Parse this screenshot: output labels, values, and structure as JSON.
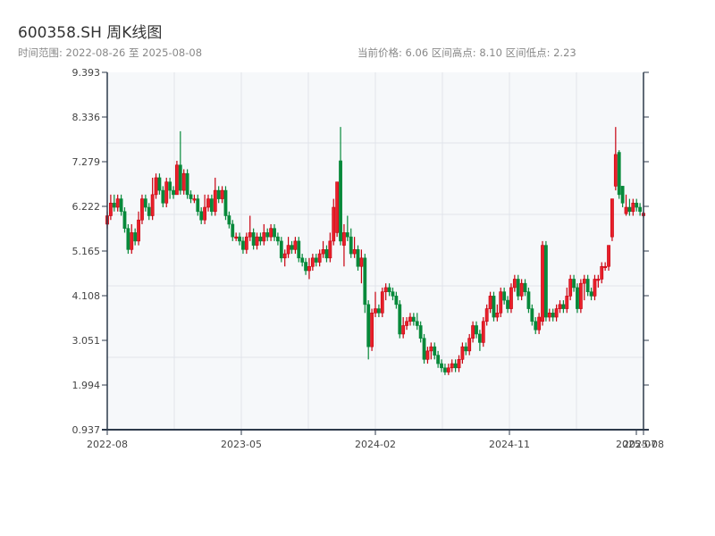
{
  "header": {
    "title": "600358.SH 周K线图",
    "range_text": "时间范围: 2022-08-26 至 2025-08-08",
    "stats_text": "当前价格: 6.06  区间高点: 8.10  区间低点: 2.23"
  },
  "chart_data": {
    "type": "candlestick",
    "title": "600358.SH 周K线图",
    "date_range": [
      "2022-08-26",
      "2025-08-08"
    ],
    "frequency": "weekly",
    "ylim": [
      0.937,
      9.393
    ],
    "y_ticks": [
      "0.937",
      "1.994",
      "3.051",
      "4.108",
      "5.165",
      "6.222",
      "7.279",
      "8.336",
      "9.393"
    ],
    "x_ticks": [
      "2022-08",
      "2023-05",
      "2024-02",
      "2024-11",
      "2025-07",
      "2025-08"
    ],
    "grid": true,
    "colors": {
      "up": "#e8202a",
      "up_edge": "#c8000f",
      "down": "#07893a",
      "background": "#f6f8fa"
    },
    "ohlc_fields": [
      "open",
      "high",
      "low",
      "close"
    ],
    "candles": [
      [
        5.8,
        6.1,
        5.7,
        6.0
      ],
      [
        6.0,
        6.5,
        5.9,
        6.3
      ],
      [
        6.3,
        6.5,
        6.1,
        6.2
      ],
      [
        6.2,
        6.5,
        6.1,
        6.4
      ],
      [
        6.4,
        6.5,
        6.0,
        6.1
      ],
      [
        6.1,
        6.2,
        5.6,
        5.7
      ],
      [
        5.7,
        5.8,
        5.1,
        5.2
      ],
      [
        5.2,
        5.8,
        5.1,
        5.6
      ],
      [
        5.6,
        5.7,
        5.3,
        5.4
      ],
      [
        5.4,
        6.1,
        5.3,
        5.9
      ],
      [
        5.9,
        6.5,
        5.8,
        6.4
      ],
      [
        6.4,
        6.5,
        6.1,
        6.2
      ],
      [
        6.2,
        6.3,
        5.9,
        6.0
      ],
      [
        6.0,
        6.9,
        5.9,
        6.5
      ],
      [
        6.5,
        7.0,
        6.4,
        6.9
      ],
      [
        6.9,
        7.0,
        6.5,
        6.6
      ],
      [
        6.6,
        6.7,
        6.2,
        6.3
      ],
      [
        6.3,
        6.9,
        6.2,
        6.8
      ],
      [
        6.8,
        6.9,
        6.4,
        6.6
      ],
      [
        6.6,
        6.7,
        6.4,
        6.5
      ],
      [
        6.5,
        7.3,
        6.5,
        7.2
      ],
      [
        7.2,
        8.0,
        6.5,
        6.6
      ],
      [
        6.6,
        7.1,
        6.5,
        7.0
      ],
      [
        7.0,
        7.1,
        6.4,
        6.5
      ],
      [
        6.5,
        6.6,
        6.3,
        6.4
      ],
      [
        6.4,
        6.5,
        6.3,
        6.4
      ],
      [
        6.4,
        6.5,
        6.0,
        6.1
      ],
      [
        6.1,
        6.2,
        5.8,
        5.9
      ],
      [
        5.9,
        6.5,
        5.8,
        6.2
      ],
      [
        6.2,
        6.5,
        6.1,
        6.4
      ],
      [
        6.4,
        6.5,
        6.0,
        6.1
      ],
      [
        6.1,
        6.9,
        6.0,
        6.6
      ],
      [
        6.6,
        6.7,
        6.3,
        6.4
      ],
      [
        6.4,
        6.7,
        6.3,
        6.6
      ],
      [
        6.6,
        6.7,
        5.9,
        6.0
      ],
      [
        6.0,
        6.1,
        5.7,
        5.8
      ],
      [
        5.8,
        5.9,
        5.4,
        5.5
      ],
      [
        5.5,
        5.6,
        5.4,
        5.5
      ],
      [
        5.5,
        5.6,
        5.3,
        5.4
      ],
      [
        5.4,
        5.5,
        5.1,
        5.2
      ],
      [
        5.2,
        5.6,
        5.1,
        5.5
      ],
      [
        5.5,
        6.0,
        5.4,
        5.6
      ],
      [
        5.6,
        5.7,
        5.2,
        5.3
      ],
      [
        5.3,
        5.6,
        5.2,
        5.5
      ],
      [
        5.5,
        5.6,
        5.3,
        5.4
      ],
      [
        5.4,
        5.8,
        5.3,
        5.6
      ],
      [
        5.6,
        5.7,
        5.4,
        5.5
      ],
      [
        5.5,
        5.8,
        5.4,
        5.7
      ],
      [
        5.7,
        5.8,
        5.4,
        5.5
      ],
      [
        5.5,
        5.6,
        5.3,
        5.4
      ],
      [
        5.4,
        5.5,
        4.9,
        5.0
      ],
      [
        5.0,
        5.2,
        4.8,
        5.1
      ],
      [
        5.1,
        5.5,
        5.0,
        5.3
      ],
      [
        5.3,
        5.4,
        5.1,
        5.2
      ],
      [
        5.2,
        5.5,
        5.1,
        5.4
      ],
      [
        5.4,
        5.5,
        4.9,
        5.0
      ],
      [
        5.0,
        5.1,
        4.8,
        4.9
      ],
      [
        4.9,
        5.0,
        4.6,
        4.7
      ],
      [
        4.7,
        5.0,
        4.5,
        4.8
      ],
      [
        4.8,
        5.1,
        4.7,
        5.0
      ],
      [
        5.0,
        5.1,
        4.8,
        4.9
      ],
      [
        4.9,
        5.2,
        4.8,
        5.1
      ],
      [
        5.1,
        5.4,
        5.0,
        5.2
      ],
      [
        5.2,
        5.3,
        4.9,
        5.0
      ],
      [
        5.0,
        5.6,
        4.9,
        5.4
      ],
      [
        5.4,
        6.4,
        5.3,
        6.2
      ],
      [
        5.6,
        6.8,
        5.5,
        6.8
      ],
      [
        7.3,
        8.1,
        5.3,
        5.4
      ],
      [
        5.3,
        5.8,
        4.8,
        5.6
      ],
      [
        5.6,
        6.0,
        5.4,
        5.5
      ],
      [
        5.5,
        5.7,
        5.0,
        5.1
      ],
      [
        5.1,
        5.5,
        5.0,
        5.2
      ],
      [
        5.2,
        5.3,
        4.7,
        4.8
      ],
      [
        4.8,
        5.2,
        4.4,
        5.0
      ],
      [
        5.0,
        5.1,
        3.7,
        3.9
      ],
      [
        3.9,
        4.0,
        2.6,
        2.9
      ],
      [
        2.9,
        3.8,
        2.8,
        3.7
      ],
      [
        3.7,
        4.2,
        3.6,
        3.8
      ],
      [
        3.8,
        3.9,
        3.6,
        3.7
      ],
      [
        3.7,
        4.3,
        3.6,
        4.2
      ],
      [
        4.2,
        4.4,
        4.0,
        4.3
      ],
      [
        4.3,
        4.4,
        4.1,
        4.2
      ],
      [
        4.2,
        4.3,
        4.0,
        4.1
      ],
      [
        4.1,
        4.2,
        3.8,
        3.9
      ],
      [
        3.9,
        4.0,
        3.1,
        3.2
      ],
      [
        3.2,
        3.6,
        3.1,
        3.4
      ],
      [
        3.4,
        3.6,
        3.3,
        3.5
      ],
      [
        3.5,
        3.7,
        3.4,
        3.6
      ],
      [
        3.6,
        3.7,
        3.4,
        3.5
      ],
      [
        3.5,
        3.7,
        3.3,
        3.4
      ],
      [
        3.4,
        3.5,
        3.0,
        3.1
      ],
      [
        3.1,
        3.2,
        2.5,
        2.6
      ],
      [
        2.6,
        2.9,
        2.5,
        2.8
      ],
      [
        2.8,
        3.0,
        2.6,
        2.9
      ],
      [
        2.9,
        3.0,
        2.6,
        2.7
      ],
      [
        2.7,
        2.8,
        2.4,
        2.5
      ],
      [
        2.5,
        2.6,
        2.3,
        2.4
      ],
      [
        2.4,
        2.5,
        2.23,
        2.3
      ],
      [
        2.3,
        2.5,
        2.23,
        2.4
      ],
      [
        2.4,
        2.6,
        2.3,
        2.5
      ],
      [
        2.5,
        2.6,
        2.3,
        2.4
      ],
      [
        2.4,
        2.7,
        2.3,
        2.6
      ],
      [
        2.6,
        3.0,
        2.5,
        2.9
      ],
      [
        2.9,
        3.0,
        2.7,
        2.8
      ],
      [
        2.8,
        3.2,
        2.7,
        3.1
      ],
      [
        3.1,
        3.5,
        3.0,
        3.4
      ],
      [
        3.4,
        3.5,
        3.1,
        3.2
      ],
      [
        3.2,
        3.3,
        2.8,
        3.0
      ],
      [
        3.0,
        3.6,
        2.9,
        3.5
      ],
      [
        3.5,
        3.9,
        3.4,
        3.8
      ],
      [
        3.8,
        4.2,
        3.7,
        4.1
      ],
      [
        4.1,
        4.2,
        3.5,
        3.6
      ],
      [
        3.6,
        3.9,
        3.5,
        3.7
      ],
      [
        3.7,
        4.3,
        3.6,
        4.2
      ],
      [
        4.2,
        4.3,
        3.9,
        4.0
      ],
      [
        4.0,
        4.1,
        3.7,
        3.8
      ],
      [
        3.8,
        4.4,
        3.7,
        4.3
      ],
      [
        4.3,
        4.6,
        4.2,
        4.5
      ],
      [
        4.5,
        4.6,
        4.0,
        4.1
      ],
      [
        4.1,
        4.5,
        4.0,
        4.4
      ],
      [
        4.4,
        4.5,
        4.1,
        4.2
      ],
      [
        4.2,
        4.3,
        3.7,
        3.8
      ],
      [
        3.8,
        3.9,
        3.4,
        3.5
      ],
      [
        3.5,
        3.6,
        3.2,
        3.3
      ],
      [
        3.3,
        3.7,
        3.2,
        3.6
      ],
      [
        3.5,
        5.4,
        3.4,
        5.3
      ],
      [
        5.3,
        5.4,
        3.5,
        3.6
      ],
      [
        3.6,
        3.8,
        3.5,
        3.7
      ],
      [
        3.7,
        3.8,
        3.5,
        3.6
      ],
      [
        3.6,
        3.9,
        3.5,
        3.8
      ],
      [
        3.8,
        4.0,
        3.7,
        3.9
      ],
      [
        3.9,
        4.0,
        3.7,
        3.8
      ],
      [
        3.8,
        4.3,
        3.7,
        4.1
      ],
      [
        4.1,
        4.6,
        4.0,
        4.5
      ],
      [
        4.5,
        4.6,
        4.2,
        4.3
      ],
      [
        4.3,
        4.4,
        3.7,
        3.8
      ],
      [
        3.8,
        4.5,
        3.7,
        4.4
      ],
      [
        4.4,
        4.6,
        4.0,
        4.5
      ],
      [
        4.5,
        4.6,
        4.1,
        4.2
      ],
      [
        4.2,
        4.3,
        4.0,
        4.1
      ],
      [
        4.1,
        4.6,
        4.0,
        4.5
      ],
      [
        4.5,
        4.6,
        4.3,
        4.5
      ],
      [
        4.5,
        4.9,
        4.4,
        4.8
      ],
      [
        4.8,
        4.9,
        4.7,
        4.8
      ],
      [
        4.8,
        5.3,
        4.7,
        5.3
      ],
      [
        5.5,
        6.4,
        5.4,
        6.4
      ],
      [
        6.7,
        8.1,
        6.6,
        7.45
      ],
      [
        7.5,
        7.55,
        6.4,
        6.5
      ],
      [
        6.7,
        6.7,
        6.2,
        6.3
      ],
      [
        6.05,
        6.5,
        6.0,
        6.2
      ],
      [
        6.2,
        6.4,
        6.0,
        6.1
      ],
      [
        6.1,
        6.4,
        6.0,
        6.3
      ],
      [
        6.3,
        6.4,
        6.1,
        6.2
      ],
      [
        6.2,
        6.3,
        6.0,
        6.1
      ],
      [
        6.0,
        6.1,
        5.95,
        6.06
      ]
    ]
  }
}
